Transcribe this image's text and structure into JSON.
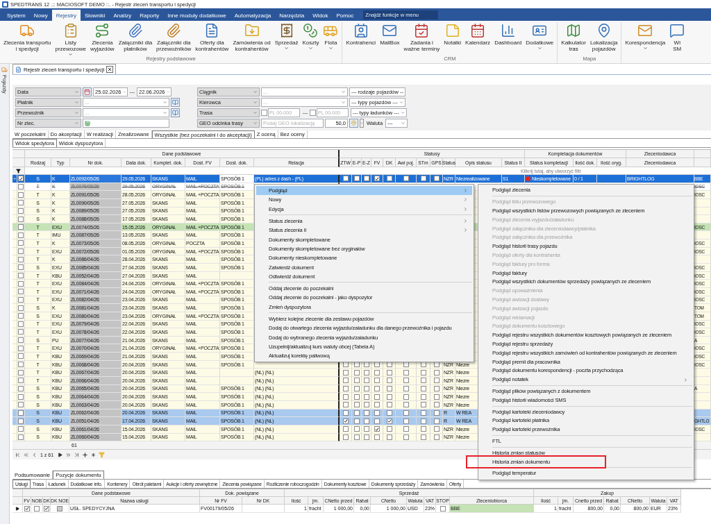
{
  "window": {
    "title": "SPEDTRANS 12 .:: MACIOSOFT DEMO ::. - Rejestr zleceń transportu i spedycji"
  },
  "menu_bar": {
    "tabs": [
      {
        "label": "System",
        "selected": false
      },
      {
        "label": "Nowy",
        "selected": false
      },
      {
        "label": "Rejestry",
        "selected": true
      },
      {
        "label": "Słowniki",
        "selected": false
      },
      {
        "label": "Analizy",
        "selected": false
      },
      {
        "label": "Raporty",
        "selected": false
      },
      {
        "label": "Inne moduły dodatkowe",
        "selected": false
      },
      {
        "label": "Automatyzacja",
        "selected": false
      },
      {
        "label": "Narzędzia",
        "selected": false
      },
      {
        "label": "Widok",
        "selected": false
      },
      {
        "label": "Pomoc",
        "selected": false
      }
    ],
    "search": {
      "placeholder": "Znajdź funkcje w menu"
    }
  },
  "ribbon": {
    "groups": [
      {
        "title": "Rejestry podstawowe",
        "buttons": [
          {
            "lines": [
              "Zlecenia transportu",
              "i spedycji"
            ],
            "dropdown": false
          },
          {
            "lines": [
              "Listy",
              "przewozowe"
            ],
            "dropdown": true
          },
          {
            "lines": [
              "Zlecenia",
              "wyjazdów"
            ],
            "dropdown": false
          },
          {
            "lines": [
              "Załączniki dla",
              "płatników"
            ],
            "dropdown": false
          },
          {
            "lines": [
              "Załączniki dla",
              "przewoźników"
            ],
            "dropdown": false
          },
          {
            "lines": [
              "Oferty dla",
              "kontrahentów"
            ],
            "dropdown": false
          },
          {
            "lines": [
              "Zamówienia od",
              "kontrahentów"
            ],
            "dropdown": false
          },
          {
            "lines": [
              "Sprzedaż"
            ],
            "dropdown": true
          },
          {
            "lines": [
              "Koszty"
            ],
            "dropdown": true
          },
          {
            "lines": [
              "Flota"
            ],
            "dropdown": true
          }
        ]
      },
      {
        "title": "CRM",
        "buttons": [
          {
            "lines": [
              "Kontrahenci"
            ],
            "dropdown": false
          },
          {
            "lines": [
              "MailBox"
            ],
            "dropdown": false
          },
          {
            "lines": [
              "Zadania i",
              "ważne terminy"
            ],
            "dropdown": false
          },
          {
            "lines": [
              "Notatki"
            ],
            "dropdown": false
          },
          {
            "lines": [
              "Kalendarz"
            ],
            "dropdown": false
          },
          {
            "lines": [
              "Dashboard"
            ],
            "dropdown": false
          },
          {
            "lines": [
              "Dodatkowe"
            ],
            "dropdown": true
          }
        ]
      },
      {
        "title": "Mapa",
        "buttons": [
          {
            "lines": [
              "Kalkulator",
              "tras"
            ],
            "dropdown": false
          },
          {
            "lines": [
              "Lokalizacja",
              "pojazdów"
            ],
            "dropdown": false
          }
        ]
      },
      {
        "buttons": [
          {
            "lines": [
              "Korespondencja"
            ],
            "dropdown": true
          },
          {
            "lines": [
              "Wi",
              "SM"
            ],
            "dropdown": false
          }
        ]
      }
    ]
  },
  "side_panel": {
    "label": "Pojazdy"
  },
  "document_tab": {
    "title": "Rejestr zleceń transportu i spedycji"
  },
  "filters": {
    "rows": [
      {
        "left": {
          "kind": "date_range",
          "label": "Data",
          "from": "25.02.2026",
          "separator": "---",
          "to": "22.06.2026"
        },
        "right": {
          "kind": "combo",
          "label": "Ciągnik",
          "value": "...",
          "extra": "--- rodzaje pojazdów --"
        }
      },
      {
        "left": {
          "kind": "lookup",
          "label": "Płatnik",
          "value": "..."
        },
        "right": {
          "kind": "combo",
          "label": "Kierowca",
          "value": "...",
          "extra": "--- typy pojazdów ---"
        }
      },
      {
        "left": {
          "kind": "lookup",
          "label": "Przewoźnik",
          "value": "..."
        },
        "right": {
          "kind": "postcode_range",
          "label": "Trasa",
          "from_placeholder": "PL 00-000",
          "separator": "---",
          "to_placeholder": "PL 00-000",
          "extra": "--- typy ładunków ---"
        }
      },
      {
        "left": {
          "kind": "text",
          "label": "Nr zlec."
        },
        "right": {
          "kind": "geo",
          "label": "GEO odcinka trasy",
          "placeholder": "Podaj GEO lokalizację",
          "distance": "50,0",
          "currency_label": "Waluta",
          "currency": "---"
        }
      }
    ]
  },
  "status_tabs": [
    {
      "label": "W poczekalni",
      "selected": false
    },
    {
      "label": "Do akceptacji",
      "selected": false
    },
    {
      "label": "W realizacji",
      "selected": false
    },
    {
      "label": "Zrealizowane",
      "selected": false
    },
    {
      "label": "Wszystkie (bez poczekalni i do akceptacji)",
      "selected": true
    },
    {
      "label": "Z oceną",
      "selected": false
    },
    {
      "label": "Bez oceny",
      "selected": false
    }
  ],
  "view_tabs": [
    {
      "label": "Widok spedytora",
      "selected": true
    },
    {
      "label": "Widok dyspozytora",
      "selected": false
    }
  ],
  "grid": {
    "groups": [
      "Dane podstawowe",
      "Statusy",
      "Kompletacja dokumentów",
      "Zleceniodawca"
    ],
    "columns": [
      "Rodzaj",
      "Typ",
      "Nr dok.",
      "Data dok.",
      "Komplet. dok.",
      "Dost. FV",
      "Dost. dok.",
      "Relacja",
      "ZTW",
      "E-P",
      "E-Z",
      "FV",
      "DK",
      "Awi poj.",
      "STm",
      "GPS",
      "Status",
      "Opis statusu",
      "Status II",
      "Status kompletacji",
      "Ilość dok.",
      "Ilość oryg.",
      "Zleceniodawca"
    ],
    "filter_hint": "Kliknij tutaj, aby utworzyć filtr",
    "rows": [
      {
        "selected": true,
        "cancelled": false,
        "checked": true,
        "rodzaj": "S",
        "typ": "K",
        "nr_dok": "ZL0092/05/26",
        "data_dok": "29.05.2026",
        "komplet": "SKANS",
        "dost_fv": "MAIL",
        "dost_dok": "SPOSÓB 1",
        "relacja": "(PL) adres z dash - (PL)",
        "flags": [
          false,
          false,
          false,
          true,
          false,
          false,
          false,
          false
        ],
        "status": "NZR",
        "opis": "Niezrealizowane",
        "status_ii": "S1",
        "kompletacja": {
          "label": "Nieskompletowane",
          "color": "#e5231b"
        },
        "ilosc_dok": "0 / 1",
        "zleceniodawca": "BRIGHTLOG",
        "column_24": "BBE"
      },
      {
        "selected": false,
        "cancelled": true,
        "checked": false,
        "rodzaj": "T",
        "typ": "K",
        "nr_dok": "ZL0076/05/26",
        "data_dok": "29.05.2026",
        "komplet": "ORYGINAŁ",
        "dost_fv": "MAIL +POCZTA",
        "dost_dok": "SPOSÓB 1",
        "column_24": "IOSC"
      },
      {
        "selected": false,
        "cancelled": false,
        "checked": false,
        "rodzaj": "T",
        "typ": "K",
        "nr_dok": "ZL0091/05/26",
        "data_dok": "28.05.2026",
        "komplet": "ORYGINAŁ",
        "dost_fv": "MAIL +POCZTA",
        "dost_dok": "SPOSÓB 1",
        "column_24": "IOSC"
      },
      {
        "selected": false,
        "cancelled": false,
        "checked": false,
        "rodzaj": "S",
        "typ": "K",
        "nr_dok": "ZL0090/05/26",
        "data_dok": "27.05.2026",
        "komplet": "SKANS",
        "dost_fv": "MAIL",
        "dost_dok": "SPOSÓB 1"
      },
      {
        "selected": false,
        "cancelled": false,
        "checked": false,
        "rodzaj": "S",
        "typ": "K",
        "nr_dok": "ZL0089/05/26",
        "data_dok": "27.05.2026",
        "komplet": "SKANS",
        "dost_fv": "MAIL",
        "dost_dok": "SPOSÓB 1"
      },
      {
        "selected": false,
        "cancelled": false,
        "checked": false,
        "rodzaj": "S",
        "typ": "K",
        "nr_dok": "ZL0088/05/26",
        "data_dok": "17.05.2026",
        "komplet": "SKANS",
        "dost_fv": "MAIL",
        "dost_dok": "SPOSÓB 1"
      },
      {
        "selected": false,
        "cancelled": false,
        "checked": false,
        "color": "#c5e3b5",
        "rodzaj": "T",
        "typ": "EXU",
        "nr_dok": "ZL0074/05/26",
        "data_dok": "15.05.2026",
        "komplet": "ORYGINAŁ",
        "dost_fv": "MAIL +POCZTA",
        "dost_dok": "SPOSÓB 1",
        "column_24": "IOSC"
      },
      {
        "selected": false,
        "cancelled": false,
        "checked": false,
        "rodzaj": "T",
        "typ": "IMU",
        "nr_dok": "ZL0087/05/26",
        "data_dok": "13.05.2026",
        "komplet": "SKANS",
        "dost_fv": "MAIL",
        "dost_dok": "SPOSÓB 1"
      },
      {
        "selected": false,
        "cancelled": false,
        "checked": false,
        "rodzaj": "T",
        "typ": "K",
        "nr_dok": "ZL0073/05/26",
        "data_dok": "08.05.2026",
        "komplet": "ORYGINAŁ",
        "dost_fv": "POCZTA",
        "dost_dok": "SPOSÓB 1",
        "column_24": "IOSC"
      },
      {
        "selected": false,
        "cancelled": false,
        "checked": false,
        "rodzaj": "T",
        "typ": "EXU",
        "nr_dok": "ZL0072/05/26",
        "data_dok": "01.05.2026",
        "komplet": "ORYGINAŁ",
        "dost_fv": "MAIL +POCZTA",
        "dost_dok": "SPOSÓB 1",
        "column_24": "IOSC"
      },
      {
        "selected": false,
        "cancelled": false,
        "checked": false,
        "rodzaj": "T",
        "typ": "K",
        "nr_dok": "ZL0086/04/26",
        "data_dok": "28.04.2026",
        "komplet": "SKANS",
        "dost_fv": "MAIL",
        "dost_dok": "SPOSÓB 1"
      },
      {
        "selected": false,
        "cancelled": false,
        "checked": false,
        "rodzaj": "S",
        "typ": "EXU",
        "nr_dok": "ZL0085/04/26",
        "data_dok": "27.04.2026",
        "komplet": "SKANS",
        "dost_fv": "MAIL",
        "dost_dok": "SPOSÓB 1",
        "column_24": "IOSC"
      },
      {
        "selected": false,
        "cancelled": false,
        "checked": false,
        "rodzaj": "T",
        "typ": "KBU",
        "nr_dok": "ZL0052/04/26",
        "data_dok": "27.04.2026",
        "komplet": "SKANS",
        "dost_fv": "MAIL",
        "column_24": "IOSC"
      },
      {
        "selected": false,
        "cancelled": false,
        "checked": false,
        "rodzaj": "T",
        "typ": "EXU",
        "nr_dok": "ZL0084/04/26",
        "data_dok": "24.04.2026",
        "komplet": "ORYGINAŁ",
        "dost_fv": "MAIL +POCZTA",
        "dost_dok": "SPOSÓB 1",
        "column_24": "IOSC"
      },
      {
        "selected": false,
        "cancelled": false,
        "checked": false,
        "rodzaj": "T",
        "typ": "EXU",
        "nr_dok": "ZL0071/04/26",
        "data_dok": "24.04.2026",
        "komplet": "ORYGINAŁ",
        "dost_fv": "MAIL +POCZTA",
        "dost_dok": "SPOSÓB 1",
        "column_24": "IOSC"
      },
      {
        "selected": false,
        "cancelled": false,
        "checked": false,
        "rodzaj": "T",
        "typ": "EXU",
        "nr_dok": "ZL0082/04/26",
        "data_dok": "23.04.2026",
        "komplet": "SKANS",
        "dost_fv": "MAIL",
        "dost_dok": "SPOSÓB 1",
        "column_24": "IOSC"
      },
      {
        "selected": false,
        "cancelled": false,
        "checked": false,
        "rodzaj": "S",
        "typ": "K",
        "nr_dok": "ZL0081/04/26",
        "data_dok": "23.04.2026",
        "komplet": "SKANS",
        "dost_fv": "MAIL",
        "dost_dok": "SPOSÓB 1",
        "column_24": "TOM"
      },
      {
        "selected": false,
        "cancelled": false,
        "checked": false,
        "rodzaj": "S",
        "typ": "EXU",
        "nr_dok": "ZL0080/04/26",
        "data_dok": "23.04.2026",
        "komplet": "ORYGINAŁ",
        "dost_fv": "MAIL +POCZTA",
        "dost_dok": "SPOSÓB 1",
        "column_24": "TOM"
      },
      {
        "selected": false,
        "cancelled": false,
        "checked": false,
        "rodzaj": "T",
        "typ": "EXU",
        "nr_dok": "ZL0079/04/26",
        "data_dok": "22.04.2026",
        "komplet": "SKANS",
        "dost_fv": "MAIL",
        "dost_dok": "SPOSÓB 1",
        "column_24": "IOSC"
      },
      {
        "selected": false,
        "cancelled": false,
        "checked": false,
        "rodzaj": "T",
        "typ": "EXU",
        "nr_dok": "ZL0078/04/26",
        "data_dok": "22.04.2026",
        "komplet": "SKANS",
        "dost_fv": "MAIL",
        "dost_dok": "SPOSÓB 1",
        "column_24": "IOSC"
      },
      {
        "selected": false,
        "cancelled": false,
        "checked": false,
        "rodzaj": "S",
        "typ": "PU",
        "nr_dok": "ZL0077/04/26",
        "data_dok": "21.04.2026",
        "komplet": "SKANS",
        "dost_fv": "MAIL",
        "dost_dok": "SPOSÓB 1",
        "column_24": "A"
      },
      {
        "selected": false,
        "cancelled": false,
        "checked": false,
        "rodzaj": "T",
        "typ": "EXU",
        "nr_dok": "ZL0070/04/26",
        "data_dok": "21.04.2026",
        "komplet": "ORYGINAŁ",
        "dost_fv": "MAIL +POCZTA",
        "dost_dok": "SPOSÓB 1",
        "column_24": "IOSC"
      },
      {
        "selected": false,
        "cancelled": false,
        "checked": false,
        "rodzaj": "T",
        "typ": "KBU",
        "nr_dok": "ZL0069/04/26",
        "data_dok": "21.04.2026",
        "komplet": "SKANS",
        "dost_fv": "MAIL",
        "dost_dok": "SPOSÓB 1",
        "column_24": "IOSC"
      },
      {
        "selected": false,
        "cancelled": false,
        "checked": false,
        "rodzaj": "T",
        "typ": "KBU",
        "nr_dok": "ZL0068/04/26",
        "data_dok": "20.04.2026",
        "komplet": "SKANS",
        "dost_fv": "MAIL",
        "dost_dok": "SPOSÓB 1",
        "flags": [
          false,
          false,
          false,
          false,
          false,
          false,
          false,
          false
        ],
        "status": "NZR",
        "opis": "Niezre",
        "column_24": "IOSC"
      },
      {
        "selected": false,
        "cancelled": false,
        "checked": false,
        "rodzaj": "T",
        "typ": "KBU",
        "nr_dok": "ZL0067/04/26",
        "data_dok": "20.04.2026",
        "komplet": "SKANS",
        "dost_fv": "MAIL",
        "relacja": "(NL) (NL)",
        "flags": [
          false,
          false,
          false,
          false,
          false,
          false,
          false,
          false
        ],
        "status": "NZR",
        "opis": "Niezre"
      },
      {
        "selected": false,
        "cancelled": false,
        "checked": false,
        "rodzaj": "T",
        "typ": "KBU",
        "nr_dok": "ZL0066/04/26",
        "data_dok": "20.04.2026",
        "komplet": "SKANS",
        "dost_fv": "MAIL",
        "relacja": "(NL) (NL)",
        "flags": [
          false,
          false,
          false,
          false,
          false,
          false,
          false,
          false
        ],
        "status": "NZR",
        "opis": "Niezre"
      },
      {
        "selected": false,
        "cancelled": false,
        "checked": false,
        "rodzaj": "S",
        "typ": "KBU",
        "nr_dok": "ZL0065/04/26",
        "data_dok": "20.04.2026",
        "komplet": "SKANS",
        "dost_fv": "MAIL",
        "dost_dok": "SPOSÓB 1",
        "relacja": "(NL) (NL)",
        "flags": [
          false,
          false,
          false,
          false,
          false,
          false,
          false,
          false
        ],
        "status": "NZR",
        "opis": "Niezre",
        "column_24": "A"
      },
      {
        "selected": false,
        "cancelled": false,
        "checked": false,
        "rodzaj": "S",
        "typ": "KBU",
        "nr_dok": "ZL0064/04/26",
        "data_dok": "20.04.2026",
        "komplet": "SKANS",
        "dost_fv": "MAIL",
        "dost_dok": "SPOSÓB 1",
        "relacja": "(NL) (NL)",
        "flags": [
          false,
          false,
          false,
          false,
          false,
          false,
          false,
          false
        ],
        "status": "NZR",
        "opis": "Niezre"
      },
      {
        "selected": false,
        "cancelled": false,
        "checked": false,
        "rodzaj": "S",
        "typ": "KBU",
        "nr_dok": "ZL0063/04/26",
        "data_dok": "20.04.2026",
        "komplet": "SKANS",
        "dost_fv": "MAIL",
        "dost_dok": "SPOSÓB 1",
        "relacja": "(NL) (NL)",
        "flags": [
          false,
          false,
          false,
          false,
          false,
          false,
          false,
          false
        ],
        "status": "NZR",
        "opis": "Niezre"
      },
      {
        "selected": false,
        "cancelled": false,
        "checked": false,
        "color": "#a9c9ee",
        "rodzaj": "S",
        "typ": "KBU",
        "nr_dok": "ZL0062/04/26",
        "data_dok": "20.04.2026",
        "komplet": "SKANS",
        "dost_fv": "MAIL",
        "dost_dok": "SPOSÓB 1",
        "relacja": "(NL) (NL)",
        "flags": [
          false,
          false,
          false,
          false,
          false,
          false,
          false,
          false
        ],
        "status": "R",
        "opis": "W REA"
      },
      {
        "selected": false,
        "cancelled": false,
        "checked": false,
        "color": "#a9c9ee",
        "rodzaj": "S",
        "typ": "KBU",
        "nr_dok": "ZL0051/04/26",
        "data_dok": "17.04.2026",
        "komplet": "SKANS",
        "dost_fv": "MAIL",
        "dost_dok": "SPOSÓB 1",
        "relacja": "(NL) (NL)",
        "flags": [
          true,
          false,
          false,
          false,
          true,
          false,
          false,
          false
        ],
        "status": "R",
        "opis": "W REA",
        "column_24": "GHTLO"
      },
      {
        "selected": false,
        "cancelled": false,
        "checked": false,
        "rodzaj": "S",
        "typ": "KBU",
        "nr_dok": "ZL0061/04/26",
        "data_dok": "15.04.2026",
        "komplet": "SKANS",
        "dost_fv": "MAIL",
        "dost_dok": "SPOSÓB 1",
        "relacja": "(NL) (NL)",
        "flags": [
          false,
          false,
          false,
          true,
          false,
          false,
          false,
          false
        ],
        "status": "NZR",
        "opis": "Niezre",
        "column_24": "IOSC"
      },
      {
        "selected": false,
        "cancelled": false,
        "checked": false,
        "rodzaj": "S",
        "typ": "KBU",
        "nr_dok": "ZL0060/04/26",
        "data_dok": "15.04.2026",
        "komplet": "SKANS",
        "dost_fv": "MAIL",
        "dost_dok": "SPOSÓB 1",
        "relacja": "(NL) (NL)",
        "flags": [
          false,
          false,
          false,
          false,
          false,
          false,
          false,
          false
        ],
        "status": "NZR",
        "opis": "Niezre"
      }
    ]
  },
  "grid_footer": {
    "count": "61",
    "page": "1 z 61"
  },
  "detail_tabs": [
    {
      "label": "Podsumowanie",
      "selected": false
    },
    {
      "label": "Pozycje dokumentu",
      "selected": true
    }
  ],
  "detail_subtabs": [
    {
      "label": "Usługi",
      "selected": true
    },
    {
      "label": "Trasa",
      "selected": false
    },
    {
      "label": "Ładunek",
      "selected": false
    },
    {
      "label": "Dodatkowe info.",
      "selected": false
    },
    {
      "label": "Kontenery",
      "selected": false
    },
    {
      "label": "Obrót paletami",
      "selected": false
    },
    {
      "label": "Aukcje i oferty zewnętrzne",
      "selected": false
    },
    {
      "label": "Zlecenia powiązane",
      "selected": false
    },
    {
      "label": "Rozliczenie roboczogodzin",
      "selected": false
    },
    {
      "label": "Dokumenty kosztowe",
      "selected": false
    },
    {
      "label": "Dokumenty sprzedaży",
      "selected": false
    },
    {
      "label": "Zamówienia",
      "selected": false
    },
    {
      "label": "Oferty",
      "selected": false
    }
  ],
  "positions": {
    "groups": [
      "Dane podstawowe",
      "Dok. powiązane",
      "Sprzedaż",
      "Zakup"
    ],
    "columns": [
      "FV",
      "NOB",
      "DK",
      "DK NOE",
      "Nazwa usługi",
      "Nr FV",
      "Nr DK",
      "Ilość",
      "jm.",
      "CNetto przed",
      "Rabat",
      "CNetto",
      "Waluta",
      "VAT",
      "STOP",
      "Zleceniobiorca",
      "Ilość",
      "jm.",
      "Cnetto przed",
      "Rabat",
      "CNetto",
      "Waluta",
      "VAT"
    ],
    "rows": [
      {
        "fv": true,
        "nob": false,
        "dk": true,
        "dk_noe": false,
        "nazwa": "USŁ. SPEDYCYJNA",
        "nr_fv": "FV00179/05/26",
        "ilosc": "1",
        "jm": "fracht",
        "cnetto_przed": "1 000,00",
        "rabat": "0,00",
        "cnetto": "1 000,00",
        "waluta": "USD",
        "vat": "23%",
        "stop": false,
        "zleceniobiorca": "BBE",
        "zakup_ilosc": "1",
        "zakup_jm": "fracht",
        "zakup_cnetto_przed": "800,00",
        "zakup_rabat": "0,00",
        "zakup_cnetto": "800,00",
        "zakup_waluta": "EUR",
        "zakup_vat": "23%"
      }
    ]
  },
  "context_menu": {
    "groups": [
      [
        {
          "label": "Podgląd",
          "submenu": true,
          "highlighted": true
        },
        {
          "label": "Nowy",
          "submenu": true,
          "highlighted": false
        },
        {
          "label": "Edycja",
          "submenu": true,
          "highlighted": false
        }
      ],
      [
        {
          "label": "Status zlecenia",
          "submenu": true,
          "highlighted": false
        },
        {
          "label": "Status zlecenia II",
          "submenu": true,
          "highlighted": false
        },
        {
          "label": "Dokumenty skompletowane",
          "submenu": false,
          "highlighted": false
        },
        {
          "label": "Dokumenty skompletowane bez oryginałów",
          "submenu": false,
          "highlighted": false
        },
        {
          "label": "Dokumenty nieskompletowane",
          "submenu": false,
          "highlighted": false
        },
        {
          "label": "Zatwierdź dokument",
          "submenu": false,
          "highlighted": false
        },
        {
          "label": "Odtwierdź dokument",
          "submenu": false,
          "highlighted": false
        }
      ],
      [
        {
          "label": "Oddaj zlecenie do poczekalni",
          "submenu": false,
          "highlighted": false
        },
        {
          "label": "Oddaj zlecenie do poczekalni - jako dyspozytor",
          "submenu": false,
          "highlighted": false
        },
        {
          "label": "Zmień dyspozytora",
          "submenu": false,
          "highlighted": false
        }
      ],
      [
        {
          "label": "Wybierz kolejne zlecenie dla zestawu pojazdów",
          "submenu": false,
          "highlighted": false
        },
        {
          "label": "Dodaj do otwartego zlecenia wyjazdu/załadunku dla danego przewoźnika i pojazdu",
          "submenu": false,
          "highlighted": false
        },
        {
          "label": "Dodaj do wybranego zlecenia wyjazdu/załadunku",
          "submenu": false,
          "highlighted": false
        },
        {
          "label": "Uzupełnij/aktualizuj kurs waluty obcej (Tabela A)",
          "submenu": false,
          "highlighted": false
        },
        {
          "label": "Aktualizuj korektę paliwową",
          "submenu": false,
          "highlighted": false
        }
      ]
    ]
  },
  "submenu": {
    "groups": [
      [
        {
          "label": "Podgląd zlecenia",
          "disabled": false,
          "submenu": false,
          "marked": false
        }
      ],
      [
        {
          "label": "Podgląd listu przewozowego",
          "disabled": true,
          "submenu": false,
          "marked": false
        },
        {
          "label": "Podgląd wszystkich listów przewozowych powiązanych ze zleceniem",
          "disabled": false,
          "submenu": false,
          "marked": false
        },
        {
          "label": "Podgląd zlecenia wyjazdu/załadunku",
          "disabled": true,
          "submenu": false,
          "marked": false
        },
        {
          "label": "Podgląd załącznika dla zleceniodawcy/płatnika",
          "disabled": true,
          "submenu": false,
          "marked": false
        },
        {
          "label": "Podgląd załącznika dla przewoźnika",
          "disabled": true,
          "submenu": false,
          "marked": false
        },
        {
          "label": "Podgląd historii trasy pojazdu",
          "disabled": false,
          "submenu": false,
          "marked": false
        },
        {
          "label": "Podgląd oferty dla kontrahenta",
          "disabled": true,
          "submenu": false,
          "marked": false
        },
        {
          "label": "Podgląd faktury pro forma",
          "disabled": true,
          "submenu": false,
          "marked": false
        },
        {
          "label": "Podgląd faktury",
          "disabled": false,
          "submenu": false,
          "marked": false
        },
        {
          "label": "Podgląd wszystkich dokumentów sprzedaży powiązanych ze zleceniem",
          "disabled": false,
          "submenu": false,
          "marked": false
        },
        {
          "label": "Podgląd upoważnienia",
          "disabled": true,
          "submenu": false,
          "marked": false
        },
        {
          "label": "Podgląd awizacji dostawy",
          "disabled": true,
          "submenu": false,
          "marked": false
        },
        {
          "label": "Podgląd awizacji pojazdu",
          "disabled": true,
          "submenu": false,
          "marked": false
        },
        {
          "label": "Podgląd reklamacji",
          "disabled": true,
          "submenu": false,
          "marked": false
        },
        {
          "label": "Podgląd dokumentu kosztowego",
          "disabled": true,
          "submenu": false,
          "marked": false
        },
        {
          "label": "Podgląd rejestru wszystkich dokumentów kosztowych powiązanych ze zleceniem",
          "disabled": false,
          "submenu": false,
          "marked": false
        },
        {
          "label": "Podgląd rejestru sprzedaży",
          "disabled": false,
          "submenu": false,
          "marked": false
        },
        {
          "label": "Podgląd rejestru wszystkich zamówień od kontrahentów powiązanych ze zleceniem",
          "disabled": false,
          "submenu": false,
          "marked": false
        },
        {
          "label": "Podgląd premii dla pracownika",
          "disabled": false,
          "submenu": false,
          "marked": false
        },
        {
          "label": "Podgląd dokumentu korespondencji - poczta przychodząca",
          "disabled": false,
          "submenu": false,
          "marked": false
        },
        {
          "label": "Podgląd notatek",
          "disabled": false,
          "submenu": true,
          "marked": false
        }
      ],
      [
        {
          "label": "Podgląd plików powiązanych z dokumentem",
          "disabled": false,
          "submenu": false,
          "marked": false
        },
        {
          "label": "Podgląd historii wiadomości SMS",
          "disabled": false,
          "submenu": false,
          "marked": false
        }
      ],
      [
        {
          "label": "Podgląd kartoteki zleceniodawcy",
          "disabled": false,
          "submenu": false,
          "marked": false
        },
        {
          "label": "Podgląd kartoteki płatnika",
          "disabled": false,
          "submenu": false,
          "marked": false
        },
        {
          "label": "Podgląd kartoteki przewoźnika",
          "disabled": false,
          "submenu": false,
          "marked": false
        }
      ],
      [
        {
          "label": "FTL",
          "disabled": false,
          "submenu": false,
          "marked": false
        }
      ],
      [
        {
          "label": "Historia zmian statusów",
          "disabled": false,
          "submenu": false,
          "marked": false
        },
        {
          "label": "Historia zmian dokumentu",
          "disabled": false,
          "submenu": false,
          "marked": true
        }
      ],
      [
        {
          "label": "Podgląd temperatur",
          "disabled": false,
          "submenu": false,
          "marked": false
        }
      ]
    ]
  }
}
